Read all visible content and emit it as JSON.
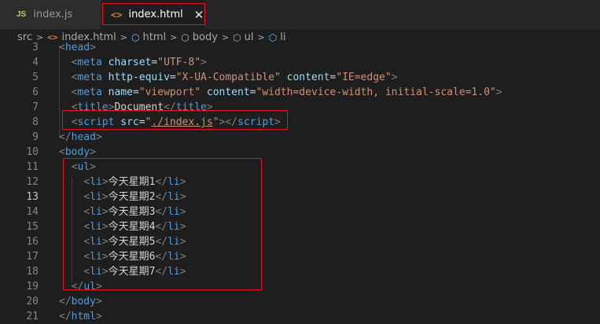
{
  "tabs": [
    {
      "icon": "JS",
      "label": "index.js"
    },
    {
      "icon": "<>",
      "label": "index.html",
      "close": "✕"
    }
  ],
  "breadcrumb": [
    "src",
    "index.html",
    "html",
    "body",
    "ul",
    "li"
  ],
  "lines": [
    {
      "num": "3",
      "html": "<span class=\"punc\">&lt;</span><span class=\"tag\">head</span><span class=\"punc\">&gt;</span>"
    },
    {
      "num": "4",
      "html": "  <span class=\"punc\">&lt;</span><span class=\"tag\">meta</span> <span class=\"attr\">charset</span><span class=\"txt\">=</span><span class=\"str\">\"UTF-8\"</span><span class=\"punc\">&gt;</span>"
    },
    {
      "num": "5",
      "html": "  <span class=\"punc\">&lt;</span><span class=\"tag\">meta</span> <span class=\"attr\">http-equiv</span><span class=\"txt\">=</span><span class=\"str\">\"X-UA-Compatible\"</span> <span class=\"attr\">content</span><span class=\"txt\">=</span><span class=\"str\">\"IE=edge\"</span><span class=\"punc\">&gt;</span>"
    },
    {
      "num": "6",
      "html": "  <span class=\"punc\">&lt;</span><span class=\"tag\">meta</span> <span class=\"attr\">name</span><span class=\"txt\">=</span><span class=\"str\">\"viewport\"</span> <span class=\"attr\">content</span><span class=\"txt\">=</span><span class=\"str\">\"width=device-width, initial-scale=1.0\"</span><span class=\"punc\">&gt;</span>"
    },
    {
      "num": "7",
      "html": "  <span class=\"punc\">&lt;</span><span class=\"tag\">title</span><span class=\"punc\">&gt;</span><span class=\"txt\">Document</span><span class=\"punc\">&lt;/</span><span class=\"tag\">title</span><span class=\"punc\">&gt;</span>"
    },
    {
      "num": "8",
      "html": "  <span class=\"punc\">&lt;</span><span class=\"tag\">script</span> <span class=\"attr\">src</span><span class=\"txt\">=</span><span class=\"str\">\"<span class=\"link\">./index.js</span>\"</span><span class=\"punc\">&gt;&lt;/</span><span class=\"tag\">script</span><span class=\"punc\">&gt;</span>"
    },
    {
      "num": "9",
      "html": "<span class=\"punc\">&lt;/</span><span class=\"tag\">head</span><span class=\"punc\">&gt;</span>"
    },
    {
      "num": "10",
      "html": "<span class=\"punc\">&lt;</span><span class=\"tag\">body</span><span class=\"punc\">&gt;</span>"
    },
    {
      "num": "11",
      "html": "  <span class=\"punc\">&lt;</span><span class=\"tag\">ul</span><span class=\"punc\">&gt;</span>"
    },
    {
      "num": "12",
      "html": "    <span class=\"punc\">&lt;</span><span class=\"tag\">li</span><span class=\"punc\">&gt;</span><span class=\"txt\">今天星期1</span><span class=\"punc\">&lt;/</span><span class=\"tag\">li</span><span class=\"punc\">&gt;</span>"
    },
    {
      "num": "13",
      "active": true,
      "html": "    <span class=\"punc\">&lt;</span><span class=\"tag\">li</span><span class=\"punc\">&gt;</span><span class=\"txt\">今天星期2</span><span class=\"punc\">&lt;/</span><span class=\"tag\">li</span><span class=\"punc\">&gt;</span>"
    },
    {
      "num": "14",
      "html": "    <span class=\"punc\">&lt;</span><span class=\"tag\">li</span><span class=\"punc\">&gt;</span><span class=\"txt\">今天星期3</span><span class=\"punc\">&lt;/</span><span class=\"tag\">li</span><span class=\"punc\">&gt;</span>"
    },
    {
      "num": "15",
      "html": "    <span class=\"punc\">&lt;</span><span class=\"tag\">li</span><span class=\"punc\">&gt;</span><span class=\"txt\">今天星期4</span><span class=\"punc\">&lt;/</span><span class=\"tag\">li</span><span class=\"punc\">&gt;</span>"
    },
    {
      "num": "16",
      "html": "    <span class=\"punc\">&lt;</span><span class=\"tag\">li</span><span class=\"punc\">&gt;</span><span class=\"txt\">今天星期5</span><span class=\"punc\">&lt;/</span><span class=\"tag\">li</span><span class=\"punc\">&gt;</span>"
    },
    {
      "num": "17",
      "html": "    <span class=\"punc\">&lt;</span><span class=\"tag\">li</span><span class=\"punc\">&gt;</span><span class=\"txt\">今天星期6</span><span class=\"punc\">&lt;/</span><span class=\"tag\">li</span><span class=\"punc\">&gt;</span>"
    },
    {
      "num": "18",
      "html": "    <span class=\"punc\">&lt;</span><span class=\"tag\">li</span><span class=\"punc\">&gt;</span><span class=\"txt\">今天星期7</span><span class=\"punc\">&lt;/</span><span class=\"tag\">li</span><span class=\"punc\">&gt;</span>"
    },
    {
      "num": "19",
      "html": "  <span class=\"punc\">&lt;/</span><span class=\"tag\">ul</span><span class=\"punc\">&gt;</span>"
    },
    {
      "num": "20",
      "html": "<span class=\"punc\">&lt;/</span><span class=\"tag\">body</span><span class=\"punc\">&gt;</span>"
    },
    {
      "num": "21",
      "html": "<span class=\"punc\">&lt;/</span><span class=\"tag\">html</span><span class=\"punc\">&gt;</span>"
    }
  ],
  "colors": {
    "background": "#1e1e1e",
    "tag": "#569cd6",
    "attr": "#9cdcfe",
    "string": "#ce9178",
    "highlight": "#e81123"
  },
  "icons": {
    "js_file": "js-file-icon",
    "html_file": "html-file-icon",
    "element": "cube-icon",
    "breadcrumb_sep": "chevron-right-icon"
  }
}
